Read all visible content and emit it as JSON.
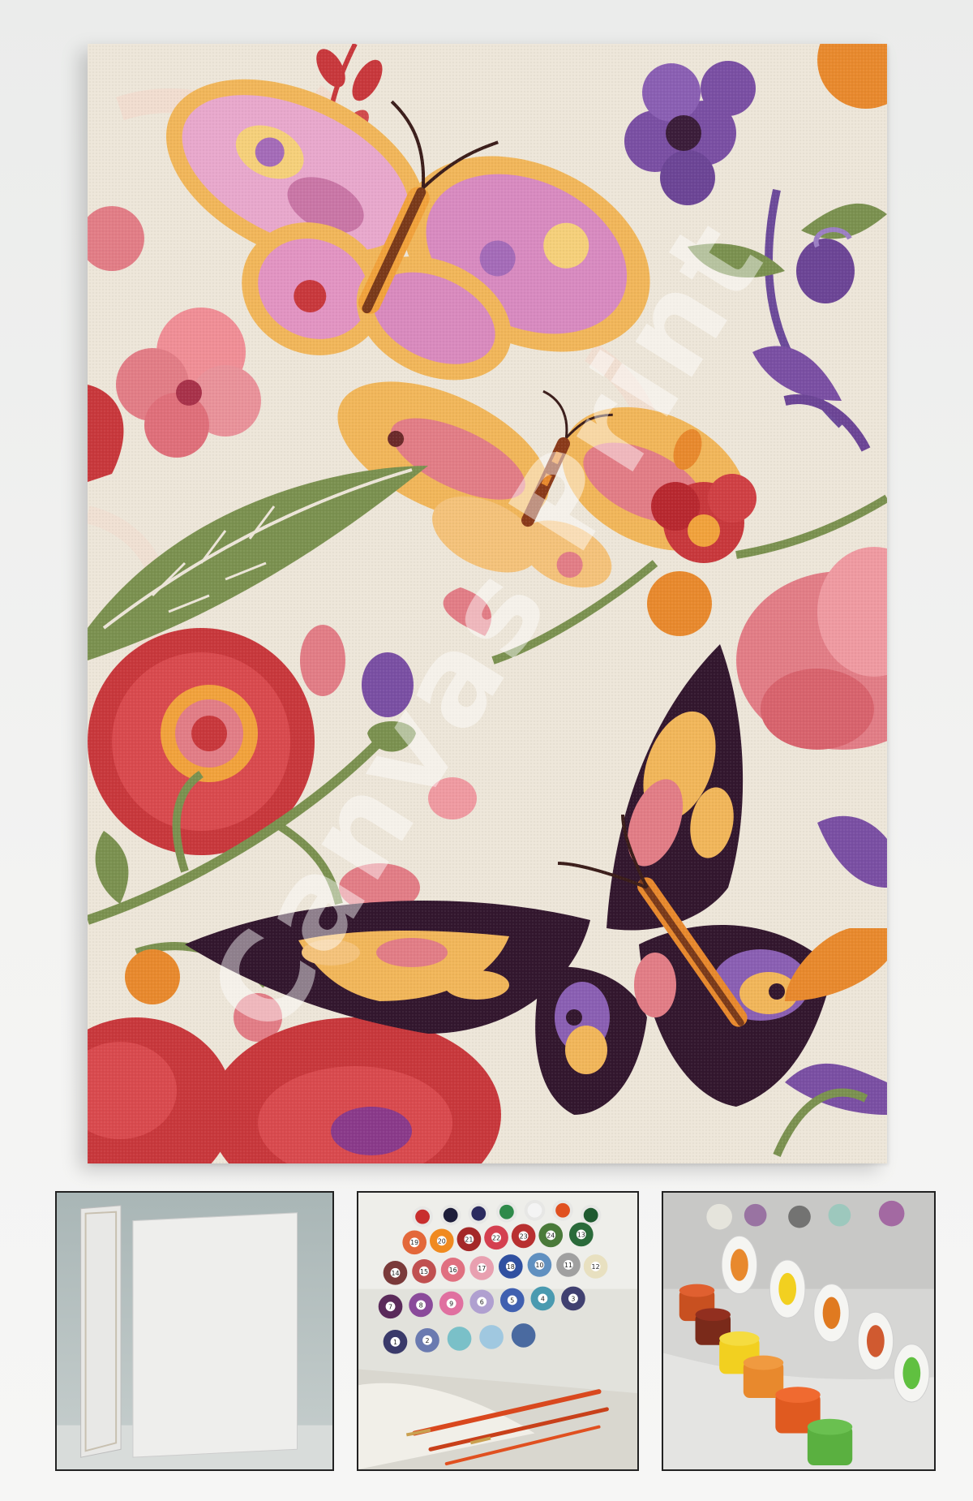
{
  "artwork": {
    "subject": "butterflies-and-flowers",
    "watermark_text": "canvas-print",
    "colors": {
      "background": "#ece5d8",
      "red": "#c8383c",
      "pink": "#e27d86",
      "orange": "#e8892d",
      "yellow": "#f1b65a",
      "purple": "#7a4fa3",
      "dark_purple": "#33172e",
      "green": "#7b9150"
    }
  },
  "thumbnails": [
    {
      "name": "blank-canvas"
    },
    {
      "name": "numbered-paint-pots",
      "labels": [
        "1",
        "2",
        "3",
        "4",
        "5",
        "6",
        "7",
        "8",
        "9",
        "10",
        "11",
        "12",
        "13",
        "14",
        "15",
        "16",
        "17",
        "18",
        "19",
        "20",
        "21",
        "22",
        "23",
        "24"
      ]
    },
    {
      "name": "open-paint-pots"
    }
  ]
}
